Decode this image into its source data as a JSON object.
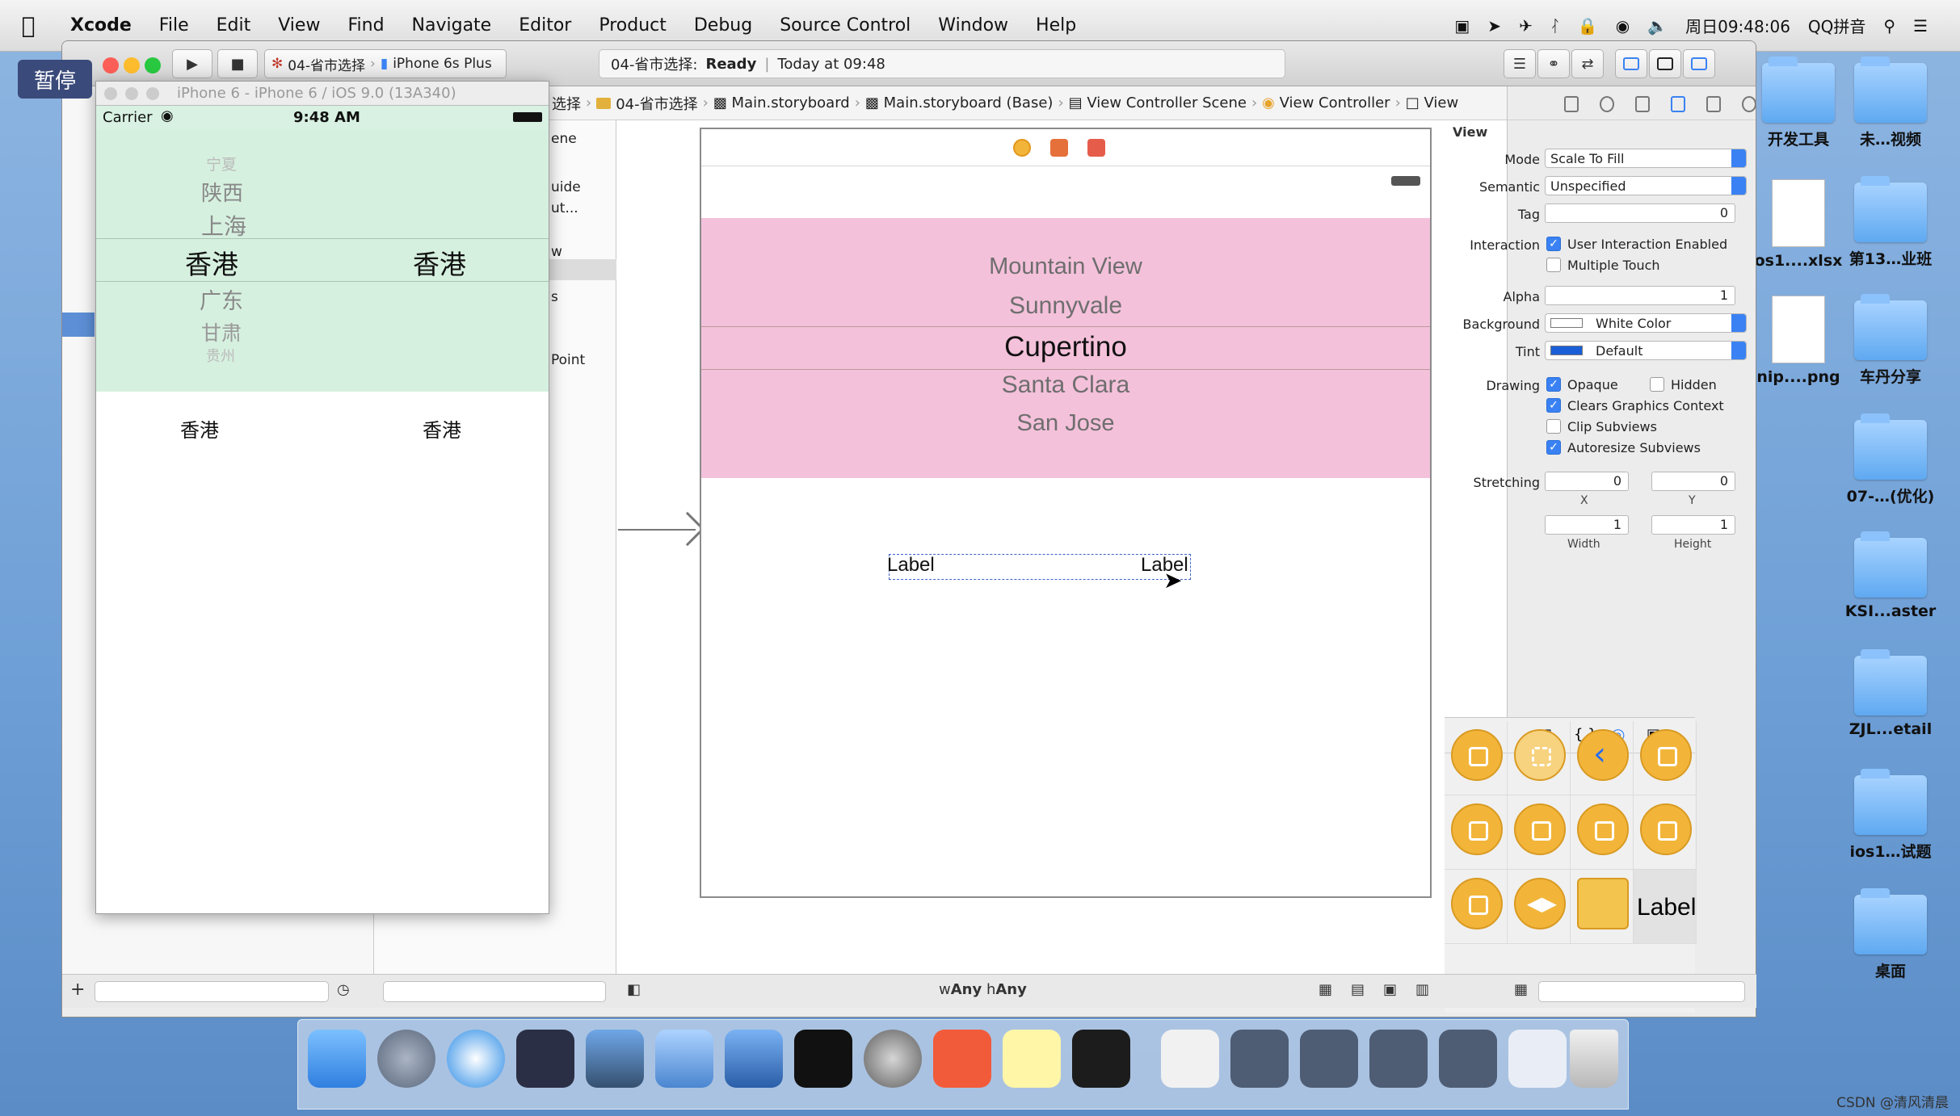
{
  "menubar": {
    "app": "Xcode",
    "items": [
      "File",
      "Edit",
      "View",
      "Find",
      "Navigate",
      "Editor",
      "Product",
      "Debug",
      "Source Control",
      "Window",
      "Help"
    ],
    "clock": "周日09:48:06",
    "input_method": "QQ拼音"
  },
  "pause_badge": "暂停",
  "toolbar": {
    "scheme_target": "04-省市选择",
    "scheme_device": "iPhone 6s Plus",
    "activity_project": "04-省市选择:",
    "activity_status": "Ready",
    "activity_time": "Today at 09:48"
  },
  "simulator": {
    "title": "iPhone 6 - iPhone 6 / iOS 9.0 (13A340)",
    "carrier": "Carrier",
    "time": "9:48 AM",
    "picker_left": [
      "宁夏",
      "陕西",
      "上海",
      "香港",
      "广东",
      "甘肃",
      "贵州"
    ],
    "picker_right_selected": "香港",
    "label_left": "香港",
    "label_right": "香港"
  },
  "outline": {
    "fragments": [
      "ene",
      "uide",
      "ut...",
      "w",
      "s",
      "Point"
    ]
  },
  "jumpbar": {
    "items": [
      "选择",
      "04-省市选择",
      "Main.storyboard",
      "Main.storyboard (Base)",
      "View Controller Scene",
      "View Controller",
      "View"
    ]
  },
  "canvas": {
    "picker_rows": [
      "Mountain View",
      "Sunnyvale",
      "Cupertino",
      "Santa Clara",
      "San Jose"
    ],
    "label_left": "Label",
    "label_right": "Label",
    "size_class_w": "Any",
    "size_class_h": "Any"
  },
  "inspector": {
    "section": "View",
    "mode_label": "Mode",
    "mode_value": "Scale To Fill",
    "semantic_label": "Semantic",
    "semantic_value": "Unspecified",
    "tag_label": "Tag",
    "tag_value": "0",
    "interaction_label": "Interaction",
    "user_interaction": "User Interaction Enabled",
    "multiple_touch": "Multiple Touch",
    "alpha_label": "Alpha",
    "alpha_value": "1",
    "background_label": "Background",
    "background_value": "White Color",
    "tint_label": "Tint",
    "tint_value": "Default",
    "drawing_label": "Drawing",
    "opaque": "Opaque",
    "hidden": "Hidden",
    "clears_graphics": "Clears Graphics Context",
    "clip_subviews": "Clip Subviews",
    "autoresize": "Autoresize Subviews",
    "stretching_label": "Stretching",
    "stretch_x": "0",
    "stretch_y": "0",
    "stretch_w": "1",
    "stretch_h": "1",
    "x_label": "X",
    "y_label": "Y",
    "width_label": "Width",
    "height_label": "Height"
  },
  "library": {
    "label_item": "Label"
  },
  "desktop": {
    "icons": [
      "开发工具",
      "未…视频",
      "os1....xlsx",
      "第13…业班",
      "nip....png",
      "车丹分享",
      "07-…(优化)",
      "KSI...aster",
      "ZJL...etail",
      "ios1…试题",
      "桌面"
    ]
  },
  "watermark": "CSDN @清风清晨"
}
